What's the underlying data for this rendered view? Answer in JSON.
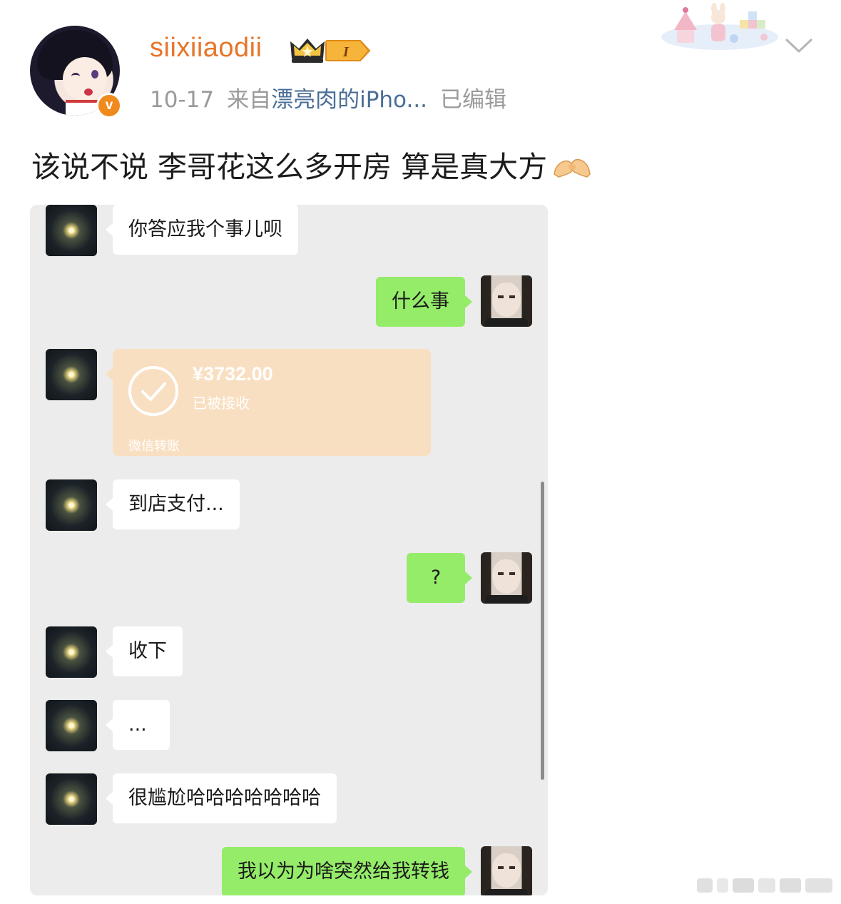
{
  "post": {
    "username": "siixiiaodii",
    "level": "I",
    "date": "10-17",
    "source_prefix": "来自",
    "source_name": "漂亮肉的iPho...",
    "edited": "已编辑",
    "verified_mark": "v",
    "text": "该说不说 李哥花这么多开房 算是真大方",
    "emoji": "pinched-fingers-emoji"
  },
  "chat": {
    "messages": [
      {
        "side": "left",
        "text": "你答应我个事儿呗"
      },
      {
        "side": "right",
        "text": "什么事"
      },
      {
        "side": "left",
        "type": "transfer"
      },
      {
        "side": "left",
        "text": "到店支付..."
      },
      {
        "side": "right",
        "text": "?"
      },
      {
        "side": "left",
        "text": "收下"
      },
      {
        "side": "left",
        "text": "..."
      },
      {
        "side": "left",
        "text": "很尴尬哈哈哈哈哈哈哈"
      },
      {
        "side": "right",
        "text": "我以为为啥突然给我转钱"
      }
    ],
    "transfer": {
      "amount": "¥3732.00",
      "status": "已被接收",
      "label": "微信转账"
    }
  },
  "colors": {
    "username": "#e8752a",
    "source_link": "#4a6e95",
    "bubble_green": "#95ec69",
    "transfer_bg": "#f9dfc1",
    "chat_bg": "#ececec"
  },
  "icons": {
    "crown": "crown-icon",
    "chevron": "chevron-down-icon",
    "check": "check-circle-icon"
  }
}
